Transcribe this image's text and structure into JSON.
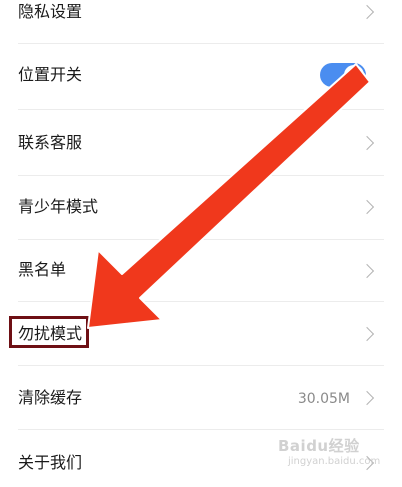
{
  "settings": {
    "items": [
      {
        "label": "隐私设置",
        "kind": "chevron"
      },
      {
        "label": "位置开关",
        "kind": "toggle",
        "on": true
      },
      {
        "label": "联系客服",
        "kind": "chevron"
      },
      {
        "label": "青少年模式",
        "kind": "chevron"
      },
      {
        "label": "黑名单",
        "kind": "chevron"
      },
      {
        "label": "勿扰模式",
        "kind": "chevron",
        "highlighted": true
      },
      {
        "label": "清除缓存",
        "kind": "chevron",
        "value": "30.05M"
      },
      {
        "label": "关于我们",
        "kind": "chevron"
      }
    ]
  },
  "colors": {
    "toggle_on": "#4a8df0",
    "arrow": "#f0381c",
    "highlight_box": "#6e0f14"
  },
  "icons": {
    "row_chevron": "chevron-right-icon",
    "annotation": "red-arrow-icon"
  },
  "watermark": {
    "text": "Baidu经验",
    "sub": "jingyan.baidu.com"
  }
}
